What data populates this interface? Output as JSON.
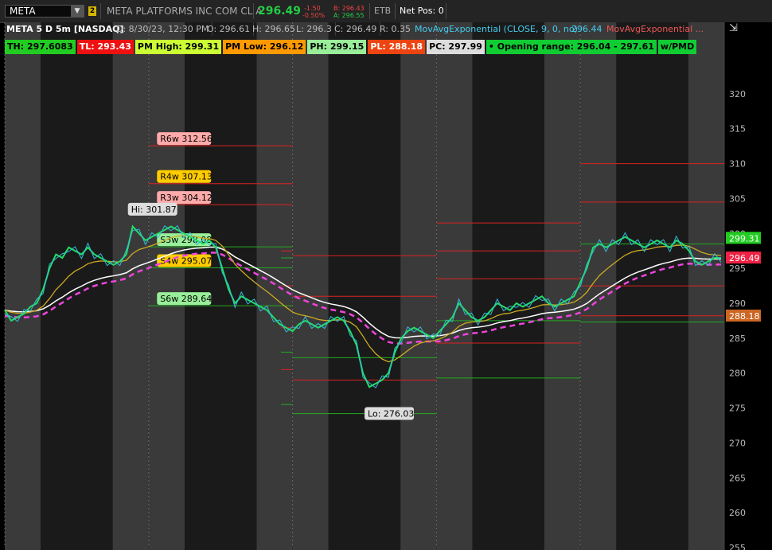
{
  "toolbar": {
    "symbol": "META",
    "link_number": "2",
    "company": "META PLATFORMS INC COM CL A",
    "last": "296.49",
    "change": "-1.50",
    "change_pct": "-0.50%",
    "bid": "B: 296.43",
    "ask": "A: 296.55",
    "exchange": "ETB",
    "net_pos": "Net Pos: 0"
  },
  "header": {
    "chart_title": "META 5 D 5m [NASDAQ]",
    "date": "D: 8/30/23, 12:30 PM",
    "open": "O: 296.61",
    "high": "H: 296.65",
    "low": "L: 296.3",
    "close": "C: 296.49",
    "range": "R: 0.35",
    "study1": "MovAvgExponential (CLOSE, 9, 0, no)",
    "study1_value": "296.44",
    "study2": "MovAvgExponential ..."
  },
  "level_labels": [
    {
      "text": "TH: 297.6083",
      "bg": "#22cc22",
      "fg": "#000000"
    },
    {
      "text": "TL: 293.43",
      "bg": "#ee1111",
      "fg": "#ffffff"
    },
    {
      "text": "PM High: 299.31",
      "bg": "#ccff33",
      "fg": "#000000"
    },
    {
      "text": "PM Low: 296.12",
      "bg": "#ff9900",
      "fg": "#000000"
    },
    {
      "text": "PH: 299.15",
      "bg": "#99ee99",
      "fg": "#000000"
    },
    {
      "text": "PL: 288.18",
      "bg": "#ee4411",
      "fg": "#ffffff"
    },
    {
      "text": "PC: 297.99",
      "bg": "#dddddd",
      "fg": "#000000"
    },
    {
      "text": "• Opening range: 296.04 - 297.61",
      "bg": "#11cc33",
      "fg": "#000000"
    },
    {
      "text": "w/PMD",
      "bg": "#11cc33",
      "fg": "#000000"
    }
  ],
  "chart_data": {
    "type": "line",
    "ylim": [
      255,
      325
    ],
    "yticks": [
      255,
      260,
      265,
      270,
      275,
      280,
      285,
      290,
      295,
      300,
      305,
      310,
      315,
      320
    ],
    "x_sessions": 5,
    "price": [
      289,
      287.5,
      288,
      288.5,
      289.5,
      290,
      292,
      295,
      297,
      296.5,
      298,
      297.5,
      297,
      298,
      297,
      296.5,
      296,
      295.5,
      296,
      297,
      301,
      300,
      299,
      299.5,
      300,
      300.5,
      301,
      300.5,
      300,
      299.5,
      299,
      298.5,
      299,
      298,
      295,
      292,
      290,
      291,
      290.5,
      290,
      289.5,
      289,
      288,
      287,
      286.5,
      286,
      287,
      287.5,
      287,
      286.5,
      287,
      287.5,
      288,
      287.5,
      286,
      284,
      280,
      278,
      278.5,
      279,
      280,
      283,
      285,
      286,
      286.5,
      286,
      285.5,
      285,
      286,
      287,
      288,
      290,
      289,
      288,
      287.5,
      288,
      289,
      290,
      289.5,
      289,
      290,
      289.5,
      290,
      290.5,
      291,
      290,
      289.5,
      290,
      290.5,
      291,
      293,
      295,
      298,
      298.5,
      298,
      298.5,
      299,
      299.5,
      299,
      298.5,
      298,
      298.5,
      299,
      298.5,
      298,
      299,
      298.5,
      297.5,
      296,
      295.5,
      296,
      296.5,
      296.49
    ],
    "ema9_value": 296.44,
    "pivots": [
      {
        "label": "R6w 312.56",
        "value": 312.56
      },
      {
        "label": "R4w 307.13",
        "value": 307.13
      },
      {
        "label": "R3w 304.12",
        "value": 304.12
      },
      {
        "label": "S3w 298.08",
        "value": 298.08
      },
      {
        "label": "S4w 295.07",
        "value": 295.07
      },
      {
        "label": "S6w 289.64",
        "value": 289.64
      }
    ],
    "annotations": [
      {
        "label": "Hi: 301.87",
        "value": 301.87
      },
      {
        "label": "Lo: 276.03",
        "value": 276.03
      }
    ],
    "axis_badges": [
      {
        "label": "299.31",
        "value": 299.31,
        "color": "#22cc22"
      },
      {
        "label": "296.49",
        "value": 296.49,
        "color": "#ee2244"
      },
      {
        "label": "288.18",
        "value": 288.18,
        "color": "#cc6622"
      }
    ]
  },
  "colors": {
    "price_up": "#22dd66",
    "price_mix": "#33bbdd",
    "ema9": "#33ccdd",
    "ema_slow": "#ccaa22",
    "vwap": "#ffffff",
    "dash": "#ee44dd",
    "green_level": "#22aa22",
    "red_level": "#dd2222",
    "band_light": "#3a3a3a",
    "band_dark": "#1a1a1a"
  }
}
